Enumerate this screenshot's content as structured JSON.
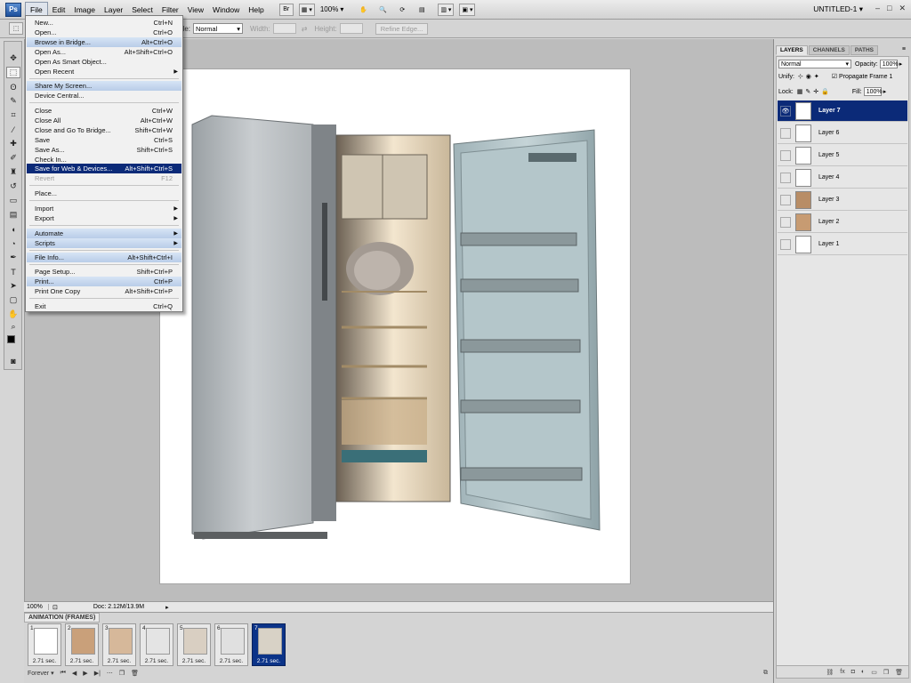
{
  "menubar": {
    "logo": "Ps",
    "menus": [
      "File",
      "Edit",
      "Image",
      "Layer",
      "Select",
      "Filter",
      "View",
      "Window",
      "Help"
    ],
    "bridge_label": "Br",
    "zoom": "100%",
    "doc_title": "UNTITLED-1"
  },
  "options": {
    "style_label": "Style:",
    "style_value": "Normal",
    "width_label": "Width:",
    "height_label": "Height:",
    "refine_edge": "Refine Edge..."
  },
  "file_menu": {
    "items": [
      {
        "label": "New...",
        "shortcut": "Ctrl+N"
      },
      {
        "label": "Open...",
        "shortcut": "Ctrl+O"
      },
      {
        "label": "Browse in Bridge...",
        "shortcut": "Alt+Ctrl+O"
      },
      {
        "label": "Open As...",
        "shortcut": "Alt+Shift+Ctrl+O"
      },
      {
        "label": "Open As Smart Object...",
        "shortcut": ""
      },
      {
        "label": "Open Recent",
        "shortcut": ""
      },
      {
        "label": "Share My Screen...",
        "shortcut": ""
      },
      {
        "label": "Device Central...",
        "shortcut": ""
      },
      {
        "label": "Close",
        "shortcut": "Ctrl+W"
      },
      {
        "label": "Close All",
        "shortcut": "Alt+Ctrl+W"
      },
      {
        "label": "Close and Go To Bridge...",
        "shortcut": "Shift+Ctrl+W"
      },
      {
        "label": "Save",
        "shortcut": "Ctrl+S"
      },
      {
        "label": "Save As...",
        "shortcut": "Shift+Ctrl+S"
      },
      {
        "label": "Check In...",
        "shortcut": ""
      },
      {
        "label": "Save for Web & Devices...",
        "shortcut": "Alt+Shift+Ctrl+S"
      },
      {
        "label": "Revert",
        "shortcut": "F12"
      },
      {
        "label": "Place...",
        "shortcut": ""
      },
      {
        "label": "Import",
        "shortcut": ""
      },
      {
        "label": "Export",
        "shortcut": ""
      },
      {
        "label": "Automate",
        "shortcut": ""
      },
      {
        "label": "Scripts",
        "shortcut": ""
      },
      {
        "label": "File Info...",
        "shortcut": "Alt+Shift+Ctrl+I"
      },
      {
        "label": "Page Setup...",
        "shortcut": "Shift+Ctrl+P"
      },
      {
        "label": "Print...",
        "shortcut": "Ctrl+P"
      },
      {
        "label": "Print One Copy",
        "shortcut": "Alt+Shift+Ctrl+P"
      },
      {
        "label": "Exit",
        "shortcut": "Ctrl+Q"
      }
    ]
  },
  "status": {
    "zoom": "100%",
    "doc": "Doc: 2.12M/13.9M"
  },
  "animation": {
    "tab": "ANIMATION (FRAMES)",
    "loop": "Forever",
    "frames": [
      {
        "num": "1",
        "delay": "2.71 sec."
      },
      {
        "num": "2",
        "delay": "2.71 sec."
      },
      {
        "num": "3",
        "delay": "2.71 sec."
      },
      {
        "num": "4",
        "delay": "2.71 sec."
      },
      {
        "num": "5",
        "delay": "2.71 sec."
      },
      {
        "num": "6",
        "delay": "2.71 sec."
      },
      {
        "num": "7",
        "delay": "2.71 sec."
      }
    ]
  },
  "layers_panel": {
    "tabs": [
      "LAYERS",
      "CHANNELS",
      "PATHS"
    ],
    "blend_mode": "Normal",
    "opacity_label": "Opacity:",
    "opacity": "100%",
    "unify_label": "Unify:",
    "propagate_label": "Propagate Frame 1",
    "lock_label": "Lock:",
    "fill_label": "Fill:",
    "fill": "100%",
    "layers": [
      "Layer 7",
      "Layer 6",
      "Layer 5",
      "Layer 4",
      "Layer 3",
      "Layer 2",
      "Layer 1"
    ]
  },
  "colors": {
    "selection": "#0b2a78",
    "menu_highlight": "#b9cde8",
    "canvas_bg": "#bcbcbc"
  }
}
